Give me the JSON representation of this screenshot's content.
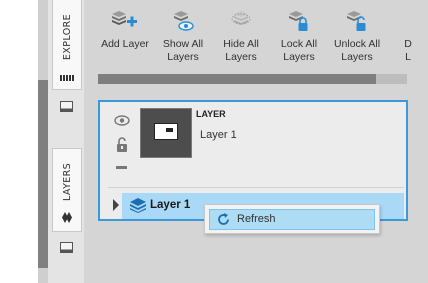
{
  "sidebar": {
    "tabs": [
      {
        "label": "EXPLORE"
      },
      {
        "label": "LAYERS"
      }
    ]
  },
  "toolbar": {
    "tools": [
      {
        "label": "Add Layer",
        "icon": "add-layer-icon"
      },
      {
        "label": "Show All Layers",
        "line1": "Show All",
        "line2": "Layers",
        "icon": "show-all-layers-icon"
      },
      {
        "label": "Hide All Layers",
        "line1": "Hide All",
        "line2": "Layers",
        "icon": "hide-all-layers-icon"
      },
      {
        "label": "Lock All Layers",
        "line1": "Lock All",
        "line2": "Layers",
        "icon": "lock-all-layers-icon"
      },
      {
        "label": "Unlock All Layers",
        "line1": "Unlock All",
        "line2": "Layers",
        "icon": "unlock-all-layers-icon"
      },
      {
        "label": "D L (truncated)",
        "line1": "D",
        "line2": "L"
      }
    ]
  },
  "layer_panel": {
    "title": "LAYER",
    "name": "Layer 1"
  },
  "layer_tree": {
    "items": [
      {
        "label": "Layer 1"
      }
    ]
  },
  "context_menu": {
    "items": [
      {
        "label": "Refresh",
        "icon": "refresh-icon"
      }
    ]
  },
  "colors": {
    "accent": "#3a9ad9",
    "selection": "#aad9f7",
    "icon_blue": "#2a8dd4"
  }
}
